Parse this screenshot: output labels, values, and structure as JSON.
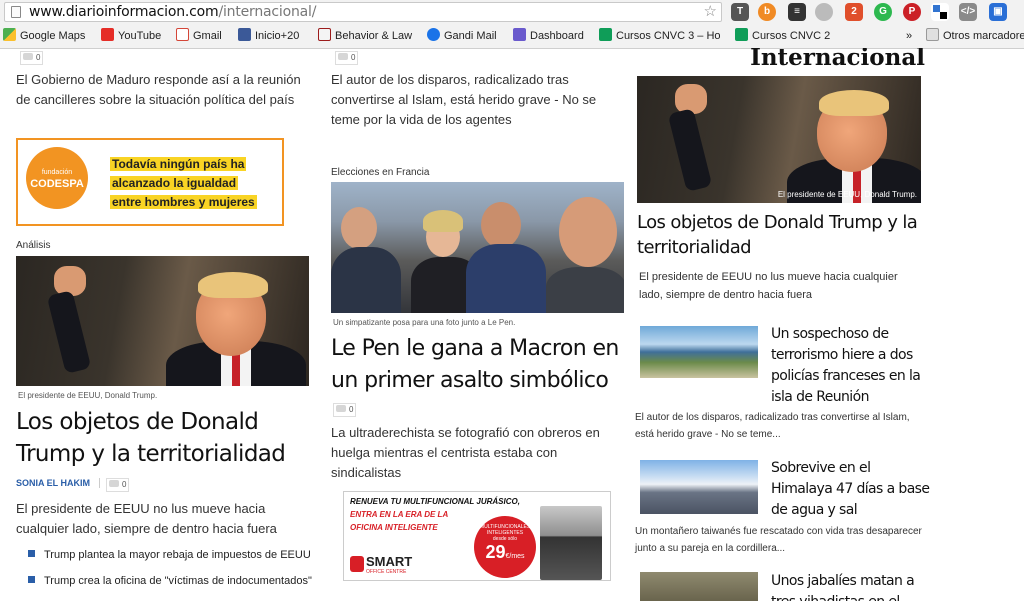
{
  "browser": {
    "url_host": "www.diarioinformacion.com",
    "url_path": "/internacional/",
    "bookmarks": [
      {
        "label": "Google Maps",
        "icon": "maps-icon",
        "color": "#4caf50"
      },
      {
        "label": "YouTube",
        "icon": "youtube-icon",
        "color": "#e52d27"
      },
      {
        "label": "Gmail",
        "icon": "gmail-icon",
        "color": "#d44638"
      },
      {
        "label": "Inicio+20",
        "icon": "facebook-icon",
        "color": "#3b5998"
      },
      {
        "label": "Behavior & Law",
        "icon": "behavior-law-icon",
        "color": "#9c1c1c"
      },
      {
        "label": "Gandi Mail",
        "icon": "gandi-icon",
        "color": "#1a73e8"
      },
      {
        "label": "Dashboard",
        "icon": "dashboard-icon",
        "color": "#6a5acd"
      },
      {
        "label": "Cursos CNVC 3 – Ho",
        "icon": "sheets-icon",
        "color": "#0f9d58"
      },
      {
        "label": "Cursos CNVC 2",
        "icon": "sheets-icon",
        "color": "#0f9d58"
      }
    ],
    "overflow_label": "»",
    "other_bookmarks": "Otros marcadores"
  },
  "section_title": "Internacional",
  "left": {
    "story1": {
      "text": "El Gobierno de Maduro responde así a la reunión de cancilleres sobre la situación política del país",
      "comments": "0"
    },
    "ad": {
      "brand_small": "fundación",
      "brand": "CODESPA",
      "line1": "Todavía ningún país ha",
      "line2": "alcanzado la igualdad",
      "line3": "entre hombres y mujeres"
    },
    "kicker": "Análisis",
    "caption": "El presidente de EEUU, Donald Trump.",
    "headline": "Los objetos de Donald Trump y la territorialidad",
    "author": "SONIA EL HAKIM",
    "comments": "0",
    "summary": "El presidente de EEUU no lus mueve hacia cualquier lado, siempre de dentro hacia fuera",
    "related": [
      "Trump plantea la mayor rebaja de impuestos de EEUU",
      "Trump crea la oficina de \"víctimas de indocumentados\""
    ]
  },
  "middle": {
    "story1": {
      "text": "El autor de los disparos, radicalizado tras convertirse al Islam, está herido grave - No se teme por la vida de los agentes"
    },
    "kicker": "Elecciones en Francia",
    "caption": "Un simpatizante posa para una foto junto a Le Pen.",
    "headline": "Le Pen le gana a Macron en un primer asalto simbólico",
    "comments": "0",
    "summary": "La ultraderechista se fotografió con obreros en huelga mientras el centrista estaba con sindicalistas",
    "ad": {
      "line1": "RENUEVA TU MULTIFUNCIONAL JURÁSICO,",
      "line2": "ENTRA EN LA ERA DE LA",
      "line3": "OFICINA INTELIGENTE",
      "badge_top": "MULTIFUNCIONALES INTELIGENTES",
      "badge_desde": "desde sólo",
      "price": "29",
      "price_unit": "€/mes",
      "brand": "SMART",
      "brand_sub": "OFFICE CENTRE"
    }
  },
  "right": {
    "caption": "El presidente de EEUU, Donald Trump.",
    "headline": "Los objetos de Donald Trump y la territorialidad",
    "summary": "El presidente de EEUU no lus mueve hacia cualquier lado, siempre de dentro hacia fuera",
    "items": [
      {
        "headline": "Un sospechoso de terrorismo hiere a dos policías franceses en la isla de Reunión",
        "summary": "El autor de los disparos, radicalizado tras convertirse al Islam, está herido grave - No se teme..."
      },
      {
        "headline": "Sobrevive en el Himalaya 47 días a base de agua y sal",
        "summary": "Un montañero taiwanés fue rescatado con vida tras desaparecer junto a su pareja en la cordillera..."
      },
      {
        "headline": "Unos jabalíes matan a tres yihadistas en el"
      }
    ]
  }
}
